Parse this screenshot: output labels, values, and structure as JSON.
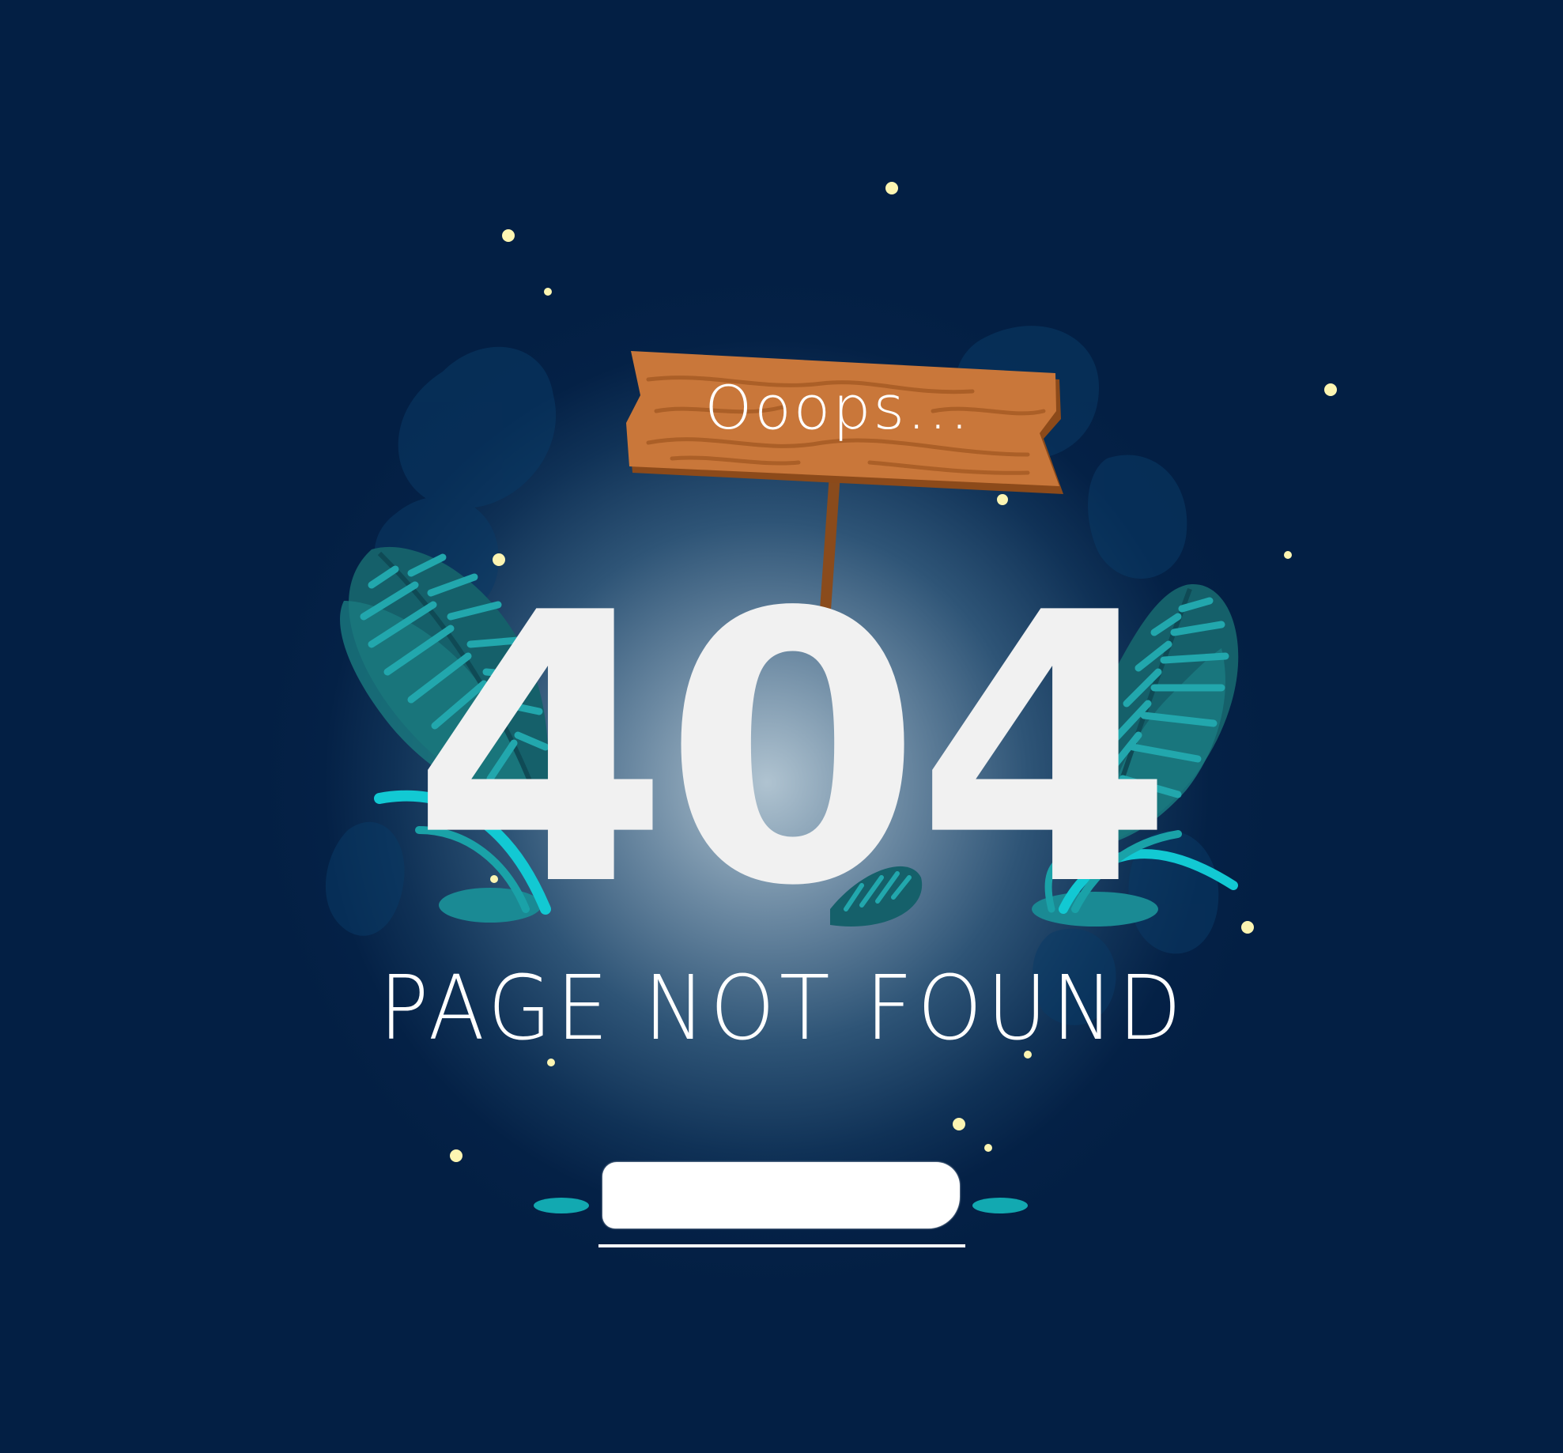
{
  "sign": {
    "text": "Ooops..."
  },
  "error": {
    "code": "404",
    "message": "PAGE NOT FOUND"
  },
  "home_button": {
    "label": ""
  },
  "colors": {
    "background": "#031f44",
    "leaf_dark": "#15606a",
    "leaf_light": "#1aa2a8",
    "grass": "#12c9d3",
    "wood": "#c9773a",
    "wood_grain": "#a65b24",
    "firefly": "#fdf5b2",
    "text": "#ffffff"
  },
  "icons": [
    "wooden-sign-icon",
    "leaf-icon",
    "grass-icon",
    "firefly-icon"
  ]
}
